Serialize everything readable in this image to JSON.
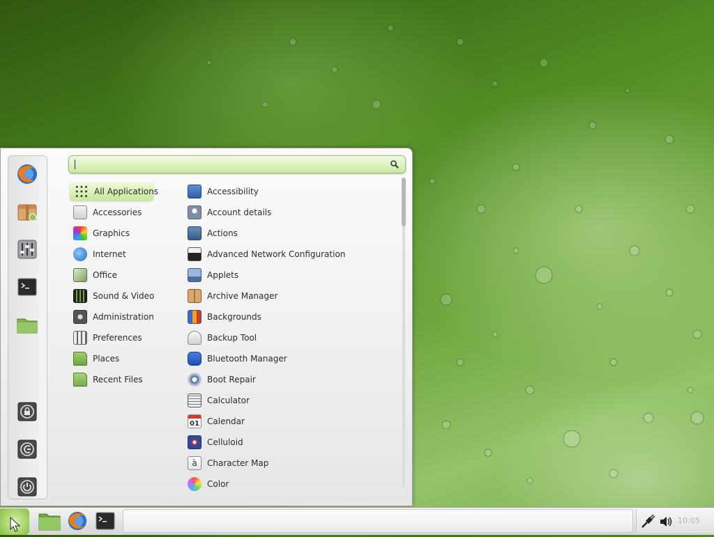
{
  "search": {
    "value": "",
    "placeholder": ""
  },
  "favorites": [
    {
      "name": "firefox-icon"
    },
    {
      "name": "software-manager-icon"
    },
    {
      "name": "system-settings-icon"
    },
    {
      "name": "terminal-icon"
    },
    {
      "name": "home-folder-icon"
    }
  ],
  "session": [
    {
      "name": "lock-screen-icon"
    },
    {
      "name": "logout-icon"
    },
    {
      "name": "shutdown-icon"
    }
  ],
  "categories": [
    {
      "label": "All Applications",
      "icon": "all-applications-icon",
      "active": true
    },
    {
      "label": "Accessories",
      "icon": "accessories-icon"
    },
    {
      "label": "Graphics",
      "icon": "graphics-icon"
    },
    {
      "label": "Internet",
      "icon": "internet-icon"
    },
    {
      "label": "Office",
      "icon": "office-icon"
    },
    {
      "label": "Sound & Video",
      "icon": "sound-video-icon"
    },
    {
      "label": "Administration",
      "icon": "administration-icon"
    },
    {
      "label": "Preferences",
      "icon": "preferences-icon"
    },
    {
      "label": "Places",
      "icon": "places-folder-icon"
    },
    {
      "label": "Recent Files",
      "icon": "recent-files-icon"
    }
  ],
  "apps": [
    {
      "label": "Accessibility",
      "icon": "accessibility-icon"
    },
    {
      "label": "Account details",
      "icon": "account-icon"
    },
    {
      "label": "Actions",
      "icon": "actions-icon"
    },
    {
      "label": "Advanced Network Configuration",
      "icon": "network-icon"
    },
    {
      "label": "Applets",
      "icon": "applets-icon"
    },
    {
      "label": "Archive Manager",
      "icon": "archive-icon"
    },
    {
      "label": "Backgrounds",
      "icon": "backgrounds-icon"
    },
    {
      "label": "Backup Tool",
      "icon": "backup-icon"
    },
    {
      "label": "Bluetooth Manager",
      "icon": "bluetooth-icon"
    },
    {
      "label": "Boot Repair",
      "icon": "boot-repair-icon"
    },
    {
      "label": "Calculator",
      "icon": "calculator-icon"
    },
    {
      "label": "Calendar",
      "icon": "calendar-icon",
      "glyph": "01"
    },
    {
      "label": "Celluloid",
      "icon": "celluloid-icon"
    },
    {
      "label": "Character Map",
      "icon": "character-map-icon",
      "glyph": "à"
    },
    {
      "label": "Color",
      "icon": "color-icon"
    }
  ],
  "panel": {
    "launchers": [
      {
        "name": "files-launcher-icon"
      },
      {
        "name": "firefox-launcher-icon"
      },
      {
        "name": "terminal-launcher-icon"
      }
    ],
    "clock": "10:05"
  },
  "colors": {
    "accent": "#a6d36a",
    "accent_dark": "#86bb48",
    "desktop": "#5b9a2c"
  }
}
